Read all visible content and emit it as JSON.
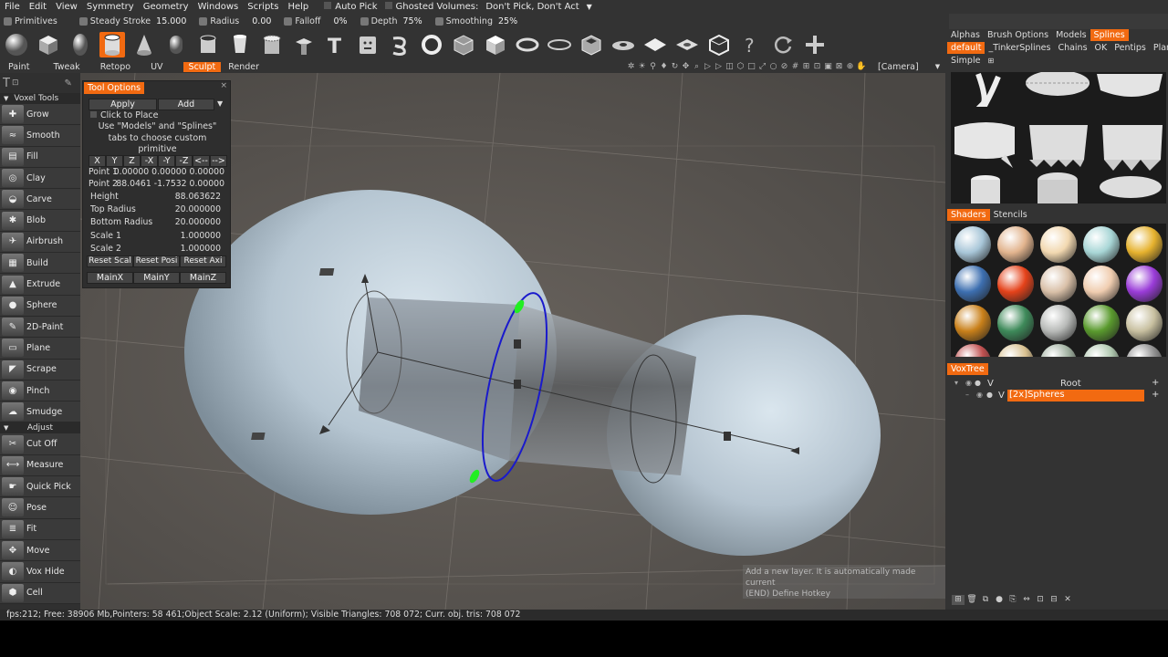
{
  "menu": {
    "items": [
      "File",
      "Edit",
      "View",
      "Symmetry",
      "Geometry",
      "Windows",
      "Scripts",
      "Help"
    ],
    "auto_pick": "Auto Pick",
    "ghosted_volumes": "Ghosted Volumes:",
    "ghosted_value": "Don't Pick, Don't Act"
  },
  "options": {
    "primitives": "Primitives",
    "steady_stroke_label": "Steady Stroke",
    "steady_stroke_value": "15.000",
    "radius_label": "Radius",
    "radius_value": "0.00",
    "falloff_label": "Falloff",
    "falloff_value": "0%",
    "depth_label": "Depth",
    "depth_value": "75%",
    "smoothing_label": "Smoothing",
    "smoothing_value": "25%"
  },
  "rooms": [
    "Paint",
    "Tweak",
    "Retopo",
    "UV",
    "Sculpt",
    "Render"
  ],
  "active_room": "Sculpt",
  "camera": "[Camera]",
  "sections": {
    "voxel_tools": "Voxel Tools",
    "adjust": "Adjust"
  },
  "voxel_tools": [
    "Grow",
    "Smooth",
    "Fill",
    "Clay",
    "Carve",
    "Blob",
    "Airbrush",
    "Build",
    "Extrude",
    "Sphere",
    "2D-Paint",
    "Plane",
    "Scrape",
    "Pinch",
    "Smudge"
  ],
  "adjust_tools": [
    "Cut Off",
    "Measure",
    "Quick Pick",
    "Pose",
    "Fit",
    "Move",
    "Vox Hide",
    "Cell"
  ],
  "tool_options": {
    "title": "Tool Options",
    "apply": "Apply",
    "add": "Add",
    "click_to_place": "Click to Place",
    "hint": "Use \"Models\" and \"Splines\" tabs to choose custom primitive",
    "axis_buttons": [
      "X",
      "Y",
      "Z",
      "-X",
      "-Y",
      "-Z",
      "<--",
      "-->"
    ],
    "point1_label": "Point 1",
    "point1_value": "0.00000 0.00000 0.00000",
    "point2_label": "Point 2",
    "point2_value": "88.0461 -1.7532 0.00000",
    "height_label": "Height",
    "height_value": "88.063622",
    "top_radius_label": "Top Radius",
    "top_radius_value": "20.000000",
    "bottom_radius_label": "Bottom Radius",
    "bottom_radius_value": "20.000000",
    "scale1_label": "Scale 1",
    "scale1_value": "1.000000",
    "scale2_label": "Scale 2",
    "scale2_value": "1.000000",
    "reset_buttons": [
      "Reset Scal",
      "Reset Posi",
      "Reset Axi"
    ],
    "main_buttons": [
      "MainX",
      "MainY",
      "MainZ"
    ]
  },
  "right_tabs": [
    "Alphas",
    "Brush Options",
    "Models",
    "Splines"
  ],
  "active_right_tab": "Splines",
  "spline_tabs": [
    "default",
    "_TinkerSplines",
    "Chains",
    "OK",
    "Pentips",
    "Plants"
  ],
  "active_spline_tab": "default",
  "simple_tab": "Simple",
  "shader_tabs": [
    "Shaders",
    "Stencils"
  ],
  "active_shader_tab": "Shaders",
  "shader_colors": [
    "#a8c6d8",
    "#e2b48e",
    "#f2d8b0",
    "#a8d6d6",
    "#e6b22e",
    "#3d6fb0",
    "#e5421a",
    "#d9c0a8",
    "#f0cdb0",
    "#9a3cd8",
    "#c9801a",
    "#3e8a5a",
    "#b8bab8",
    "#5a9a2e",
    "#c8c0a0",
    "#c05050",
    "#d8c090",
    "#a0b0a0",
    "#b0c8b0",
    "#909090"
  ],
  "voxtree": {
    "title": "VoxTree",
    "root": "Root",
    "layer": "[2x]Spheres",
    "visible_flag": "V"
  },
  "tooltip": {
    "text": "Add a new layer. It is automatically made current",
    "hotkey": "(END) Define Hotkey"
  },
  "status": "fps:212;  Free: 38906 Mb,Pointers: 58 461;Object Scale: 2.12 (Uniform); Visible Triangles: 708 072; Curr. obj. tris: 708 072",
  "colors": {
    "accent": "#f26a11",
    "bg": "#3a3a3a",
    "panel": "#333333"
  }
}
